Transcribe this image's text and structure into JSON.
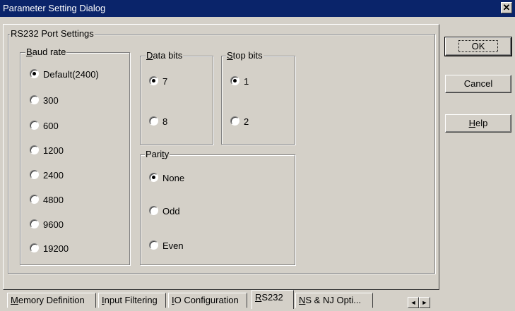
{
  "window": {
    "title": "Parameter Setting Dialog",
    "close_glyph": "✕"
  },
  "groups": {
    "rs232": "RS232 Port Settings",
    "baud": {
      "key": "B",
      "rest": "aud rate"
    },
    "data_bits": {
      "key": "D",
      "rest": "ata bits"
    },
    "stop_bits": {
      "key": "S",
      "rest": "top bits"
    },
    "parity": {
      "pre": "Pari",
      "key": "t",
      "post": "y"
    }
  },
  "baud_options": [
    "Default(2400)",
    "300",
    "600",
    "1200",
    "2400",
    "4800",
    "9600",
    "19200"
  ],
  "baud_selected": 0,
  "data_bits_options": [
    "7",
    "8"
  ],
  "data_bits_selected": 0,
  "stop_bits_options": [
    "1",
    "2"
  ],
  "stop_bits_selected": 0,
  "parity_options": [
    "None",
    "Odd",
    "Even"
  ],
  "parity_selected": 0,
  "buttons": {
    "ok": "OK",
    "cancel": "Cancel",
    "help": {
      "key": "H",
      "rest": "elp"
    }
  },
  "tabs": {
    "memory": {
      "key": "M",
      "rest": "emory Definition"
    },
    "input": {
      "key": "I",
      "rest": "nput Filtering"
    },
    "io": {
      "key": "I",
      "rest": "O Configuration"
    },
    "rs232": {
      "key": "R",
      "rest": "S232"
    },
    "ns": {
      "key": "N",
      "rest": "S & NJ Opti..."
    }
  },
  "scroll": {
    "left": "◄",
    "right": "►"
  }
}
